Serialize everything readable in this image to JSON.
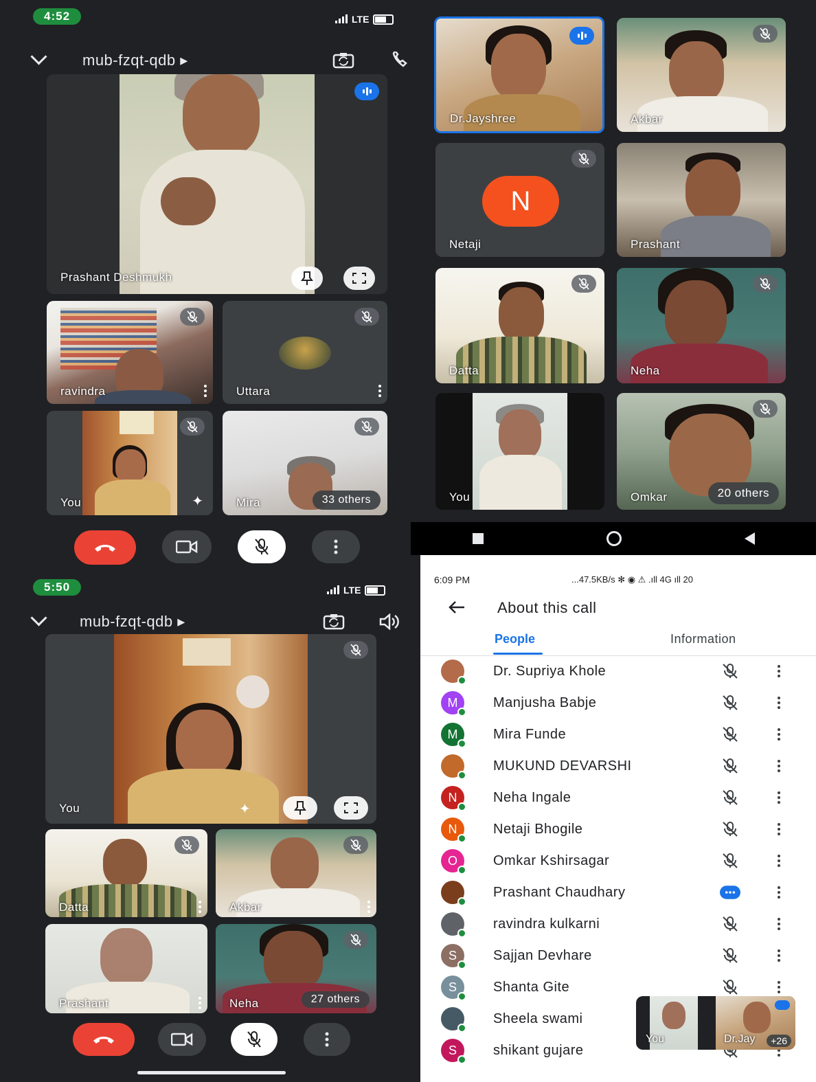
{
  "panel1": {
    "status_time": "4:52",
    "network": "LTE",
    "meet_code": "mub-fzqt-qdb ▸",
    "featured": {
      "name": "Prashant Deshmukh"
    },
    "tiles": [
      {
        "name": "ravindra"
      },
      {
        "name": "Uttara"
      },
      {
        "name": "You"
      },
      {
        "name": "Mira",
        "others": "33 others"
      }
    ]
  },
  "panel2": {
    "tiles": [
      {
        "name": "Dr.Jayshree"
      },
      {
        "name": "Akbar"
      },
      {
        "name": "Netaji",
        "initial": "N"
      },
      {
        "name": "Prashant"
      },
      {
        "name": "Datta"
      },
      {
        "name": "Neha"
      },
      {
        "name": "You"
      },
      {
        "name": "Omkar",
        "others": "20 others"
      }
    ]
  },
  "panel3": {
    "status_time": "5:50",
    "network": "LTE",
    "meet_code": "mub-fzqt-qdb ▸",
    "featured": {
      "name": "You"
    },
    "tiles": [
      {
        "name": "Datta"
      },
      {
        "name": "Akbar"
      },
      {
        "name": "Prashant"
      },
      {
        "name": "Neha",
        "others": "27 others"
      }
    ]
  },
  "panel4": {
    "status_time": "6:09 PM",
    "status_right": "...47.5KB/s ✻ ◉ ⚠ .ıll 4G ıll 20",
    "title": "About this call",
    "tabs": [
      "People",
      "Information"
    ],
    "active_tab": "People",
    "people": [
      {
        "name": "Dr. Supriya Khole",
        "initial": "",
        "color": "#b36b4a",
        "status": "muted"
      },
      {
        "name": "Manjusha Babje",
        "initial": "M",
        "color": "#a142f4",
        "status": "muted"
      },
      {
        "name": "Mira Funde",
        "initial": "M",
        "color": "#137333",
        "status": "muted"
      },
      {
        "name": "MUKUND DEVARSHI",
        "initial": "",
        "color": "#c26a2b",
        "status": "muted"
      },
      {
        "name": "Neha Ingale",
        "initial": "N",
        "color": "#c5221f",
        "status": "muted"
      },
      {
        "name": "Netaji Bhogile",
        "initial": "N",
        "color": "#e8590c",
        "status": "muted"
      },
      {
        "name": "Omkar Kshirsagar",
        "initial": "O",
        "color": "#e52592",
        "status": "muted"
      },
      {
        "name": "Prashant Chaudhary",
        "initial": "",
        "color": "#7a3e1d",
        "status": "speaking"
      },
      {
        "name": "ravindra kulkarni",
        "initial": "",
        "color": "#5f6368",
        "status": "muted"
      },
      {
        "name": "Sajjan Devhare",
        "initial": "S",
        "color": "#8d6e63",
        "status": "muted"
      },
      {
        "name": "Shanta Gite",
        "initial": "S",
        "color": "#78909c",
        "status": "muted"
      },
      {
        "name": "Sheela swami",
        "initial": "",
        "color": "#455a64",
        "status": "muted"
      },
      {
        "name": "shikant gujare",
        "initial": "S",
        "color": "#c2185b",
        "status": "muted"
      }
    ],
    "pip": {
      "left_name": "You",
      "right_name": "Dr.Jay",
      "count": "+26"
    }
  },
  "colors": {
    "end_call": "#ea4335",
    "accent": "#1a73e8",
    "bg_dark": "#202124"
  }
}
